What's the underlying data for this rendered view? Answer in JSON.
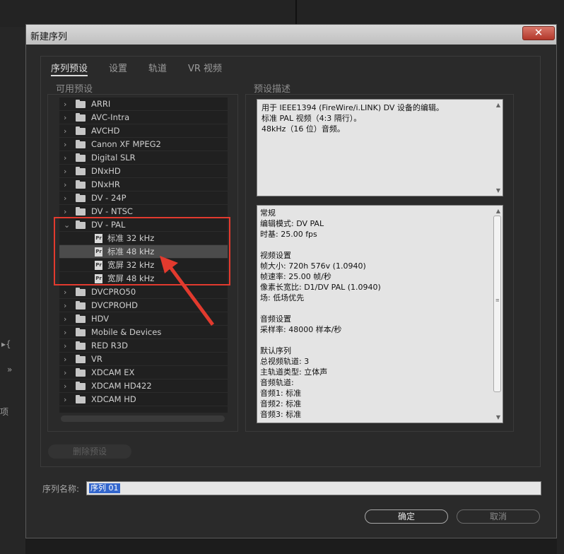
{
  "background": {
    "left_fragments": [
      "▸{",
      "»",
      "项"
    ]
  },
  "dialog": {
    "title": "新建序列",
    "close_glyph": "✕",
    "tabs": [
      {
        "label": "序列预设",
        "active": true
      },
      {
        "label": "设置",
        "active": false
      },
      {
        "label": "轨道",
        "active": false
      },
      {
        "label": "VR 视频",
        "active": false
      }
    ],
    "available_presets_label": "可用预设",
    "preset_description_label": "预设描述",
    "tree": [
      {
        "label": "ARRI",
        "type": "folder",
        "expanded": false
      },
      {
        "label": "AVC-Intra",
        "type": "folder",
        "expanded": false
      },
      {
        "label": "AVCHD",
        "type": "folder",
        "expanded": false
      },
      {
        "label": "Canon XF MPEG2",
        "type": "folder",
        "expanded": false
      },
      {
        "label": "Digital SLR",
        "type": "folder",
        "expanded": false
      },
      {
        "label": "DNxHD",
        "type": "folder",
        "expanded": false
      },
      {
        "label": "DNxHR",
        "type": "folder",
        "expanded": false
      },
      {
        "label": "DV - 24P",
        "type": "folder",
        "expanded": false
      },
      {
        "label": "DV - NTSC",
        "type": "folder",
        "expanded": false
      },
      {
        "label": "DV - PAL",
        "type": "folder",
        "expanded": true
      },
      {
        "label": "标准 32 kHz",
        "type": "preset",
        "selected": false
      },
      {
        "label": "标准 48 kHz",
        "type": "preset",
        "selected": true
      },
      {
        "label": "宽屏 32 kHz",
        "type": "preset",
        "selected": false
      },
      {
        "label": "宽屏 48 kHz",
        "type": "preset",
        "selected": false
      },
      {
        "label": "DVCPRO50",
        "type": "folder",
        "expanded": false
      },
      {
        "label": "DVCPROHD",
        "type": "folder",
        "expanded": false
      },
      {
        "label": "HDV",
        "type": "folder",
        "expanded": false
      },
      {
        "label": "Mobile & Devices",
        "type": "folder",
        "expanded": false
      },
      {
        "label": "RED R3D",
        "type": "folder",
        "expanded": false
      },
      {
        "label": "VR",
        "type": "folder",
        "expanded": false
      },
      {
        "label": "XDCAM EX",
        "type": "folder",
        "expanded": false
      },
      {
        "label": "XDCAM HD422",
        "type": "folder",
        "expanded": false
      },
      {
        "label": "XDCAM HD",
        "type": "folder",
        "expanded": false
      }
    ],
    "preset_icon_text": "Pr",
    "description_lines": [
      "用于 IEEE1394 (FireWire/i.LINK) DV 设备的编辑。",
      "标准 PAL 视频（4:3 隔行）。",
      "48kHz（16 位）音频。"
    ],
    "info_lines": [
      "常规",
      " 编辑模式: DV PAL",
      " 时基: 25.00 fps",
      "",
      "视频设置",
      " 帧大小: 720h 576v (1.0940)",
      " 帧速率: 25.00  帧/秒",
      " 像素长宽比: D1/DV PAL (1.0940)",
      " 场: 低场优先",
      "",
      "音频设置",
      " 采样率: 48000 样本/秒",
      "",
      "默认序列",
      " 总视频轨道: 3",
      " 主轨道类型: 立体声",
      " 音频轨道:",
      " 音频1: 标准",
      " 音频2: 标准",
      " 音频3: 标准"
    ],
    "delete_preset_label": "删除预设",
    "sequence_name_label": "序列名称:",
    "sequence_name_value": "序列 01",
    "ok_label": "确定",
    "cancel_label": "取消"
  },
  "colors": {
    "highlight": "#e23a2e",
    "selection": "#3366cc"
  }
}
